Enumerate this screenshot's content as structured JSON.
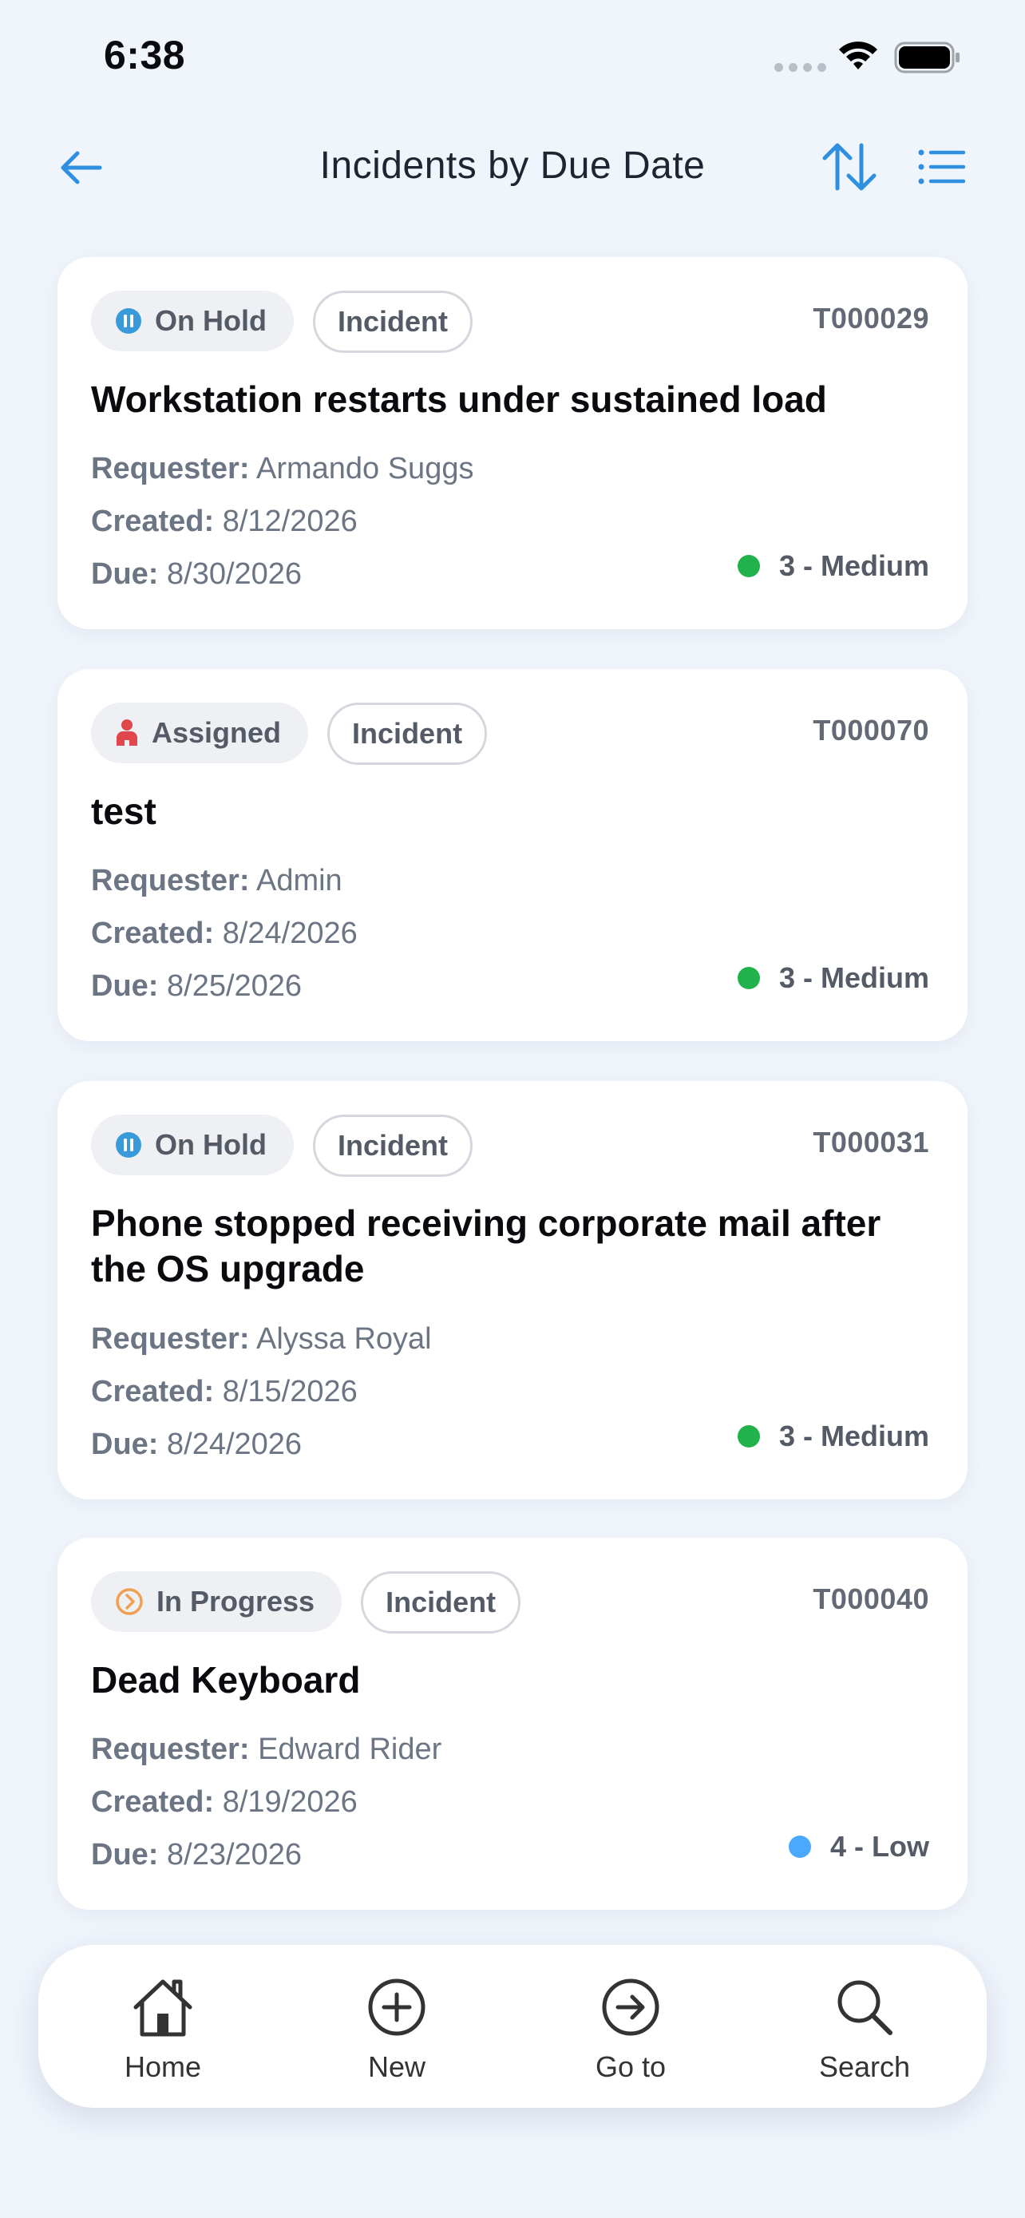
{
  "status_bar": {
    "time": "6:38"
  },
  "header": {
    "title": "Incidents by Due Date",
    "back_icon": "arrow-left-icon",
    "sort_icon": "sort-arrows-icon",
    "list_icon": "list-icon"
  },
  "labels": {
    "requester": "Requester:",
    "created": "Created:",
    "due": "Due:"
  },
  "tickets": [
    {
      "status": "On Hold",
      "status_icon": "pause-icon",
      "type": "Incident",
      "id": "T000029",
      "title": "Workstation restarts under sustained load",
      "requester": "Armando Suggs",
      "created": "8/12/2026",
      "due": "8/30/2026",
      "priority": "3 - Medium",
      "priority_color": "#22b24c"
    },
    {
      "status": "Assigned",
      "status_icon": "person-icon",
      "type": "Incident",
      "id": "T000070",
      "title": "test",
      "requester": "Admin",
      "created": "8/24/2026",
      "due": "8/25/2026",
      "priority": "3 - Medium",
      "priority_color": "#22b24c"
    },
    {
      "status": "On Hold",
      "status_icon": "pause-icon",
      "type": "Incident",
      "id": "T000031",
      "title": "Phone stopped receiving corporate mail after the OS upgrade",
      "requester": "Alyssa Royal",
      "created": "8/15/2026",
      "due": "8/24/2026",
      "priority": "3 - Medium",
      "priority_color": "#22b24c"
    },
    {
      "status": "In Progress",
      "status_icon": "progress-chevron-icon",
      "type": "Incident",
      "id": "T000040",
      "title": "Dead Keyboard",
      "requester": "Edward Rider",
      "created": "8/19/2026",
      "due": "8/23/2026",
      "priority": "4 - Low",
      "priority_color": "#4aa8ff"
    }
  ],
  "tab_bar": [
    {
      "label": "Home",
      "icon": "home-icon"
    },
    {
      "label": "New",
      "icon": "plus-circle-icon"
    },
    {
      "label": "Go to",
      "icon": "arrow-circle-icon"
    },
    {
      "label": "Search",
      "icon": "search-icon"
    }
  ],
  "colors": {
    "accent": "#2f8fe0",
    "background": "#f0f4fb",
    "on_hold": "#3a9ad9",
    "assigned": "#e0474c",
    "in_progress": "#f0a050"
  }
}
